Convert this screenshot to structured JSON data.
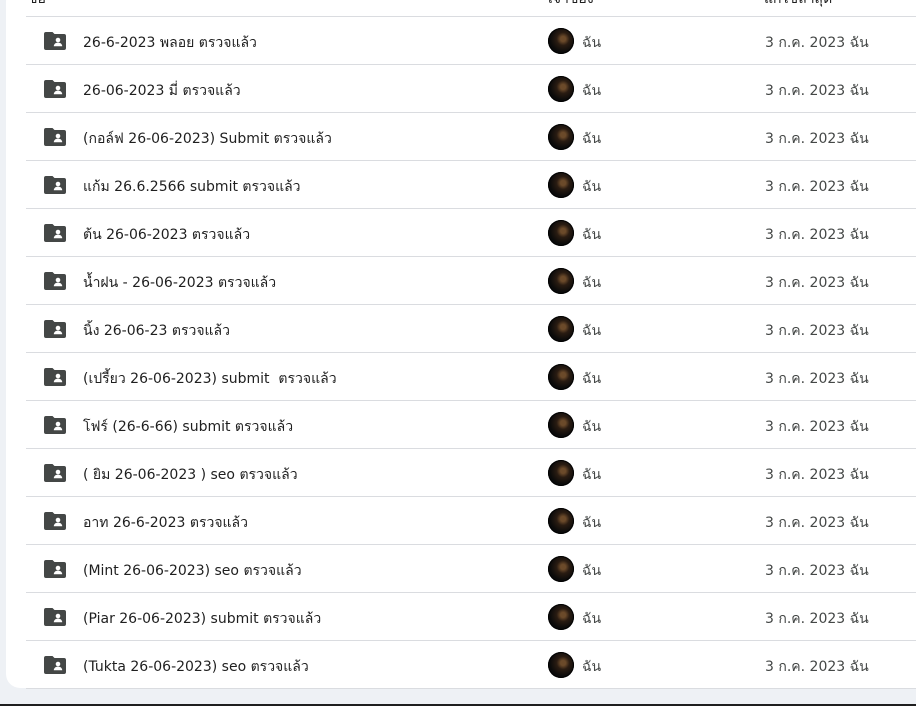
{
  "columns": {
    "name": "ชื่อ",
    "owner": "เจ้าของ",
    "modified": "แก้ไขล่าสุด"
  },
  "folder_icon": "shared-folder-icon",
  "files": [
    {
      "name": "26-6-2023 พลอย ตรวจแล้ว",
      "owner": "ฉัน",
      "modified": "3 ก.ค. 2023 ฉัน"
    },
    {
      "name": "26-06-2023 มี่ ตรวจแล้ว",
      "owner": "ฉัน",
      "modified": "3 ก.ค. 2023 ฉัน"
    },
    {
      "name": "(กอล์ฟ 26-06-2023) Submit ตรวจแล้ว",
      "owner": "ฉัน",
      "modified": "3 ก.ค. 2023 ฉัน"
    },
    {
      "name": "แก้ม 26.6.2566 submit ตรวจแล้ว",
      "owner": "ฉัน",
      "modified": "3 ก.ค. 2023 ฉัน"
    },
    {
      "name": "ต้น 26-06-2023 ตรวจแล้ว",
      "owner": "ฉัน",
      "modified": "3 ก.ค. 2023 ฉัน"
    },
    {
      "name": "น้ำฝน - 26-06-2023 ตรวจแล้ว",
      "owner": "ฉัน",
      "modified": "3 ก.ค. 2023 ฉัน"
    },
    {
      "name": "นิ้ง 26-06-23 ตรวจแล้ว",
      "owner": "ฉัน",
      "modified": "3 ก.ค. 2023 ฉัน"
    },
    {
      "name": "(เปรี้ยว 26-06-2023) submit  ตรวจแล้ว",
      "owner": "ฉัน",
      "modified": "3 ก.ค. 2023 ฉัน"
    },
    {
      "name": "โฟร์ (26-6-66) submit ตรวจแล้ว",
      "owner": "ฉัน",
      "modified": "3 ก.ค. 2023 ฉัน"
    },
    {
      "name": "( ยิม 26-06-2023 ) seo ตรวจแล้ว",
      "owner": "ฉัน",
      "modified": "3 ก.ค. 2023 ฉัน"
    },
    {
      "name": "อาท 26-6-2023 ตรวจแล้ว",
      "owner": "ฉัน",
      "modified": "3 ก.ค. 2023 ฉัน"
    },
    {
      "name": "(Mint 26-06-2023) seo ตรวจแล้ว",
      "owner": "ฉัน",
      "modified": "3 ก.ค. 2023 ฉัน"
    },
    {
      "name": "(Piar 26-06-2023) submit ตรวจแล้ว",
      "owner": "ฉัน",
      "modified": "3 ก.ค. 2023 ฉัน"
    },
    {
      "name": "(Tukta 26-06-2023) seo ตรวจแล้ว",
      "owner": "ฉัน",
      "modified": "3 ก.ค. 2023 ฉัน"
    }
  ]
}
